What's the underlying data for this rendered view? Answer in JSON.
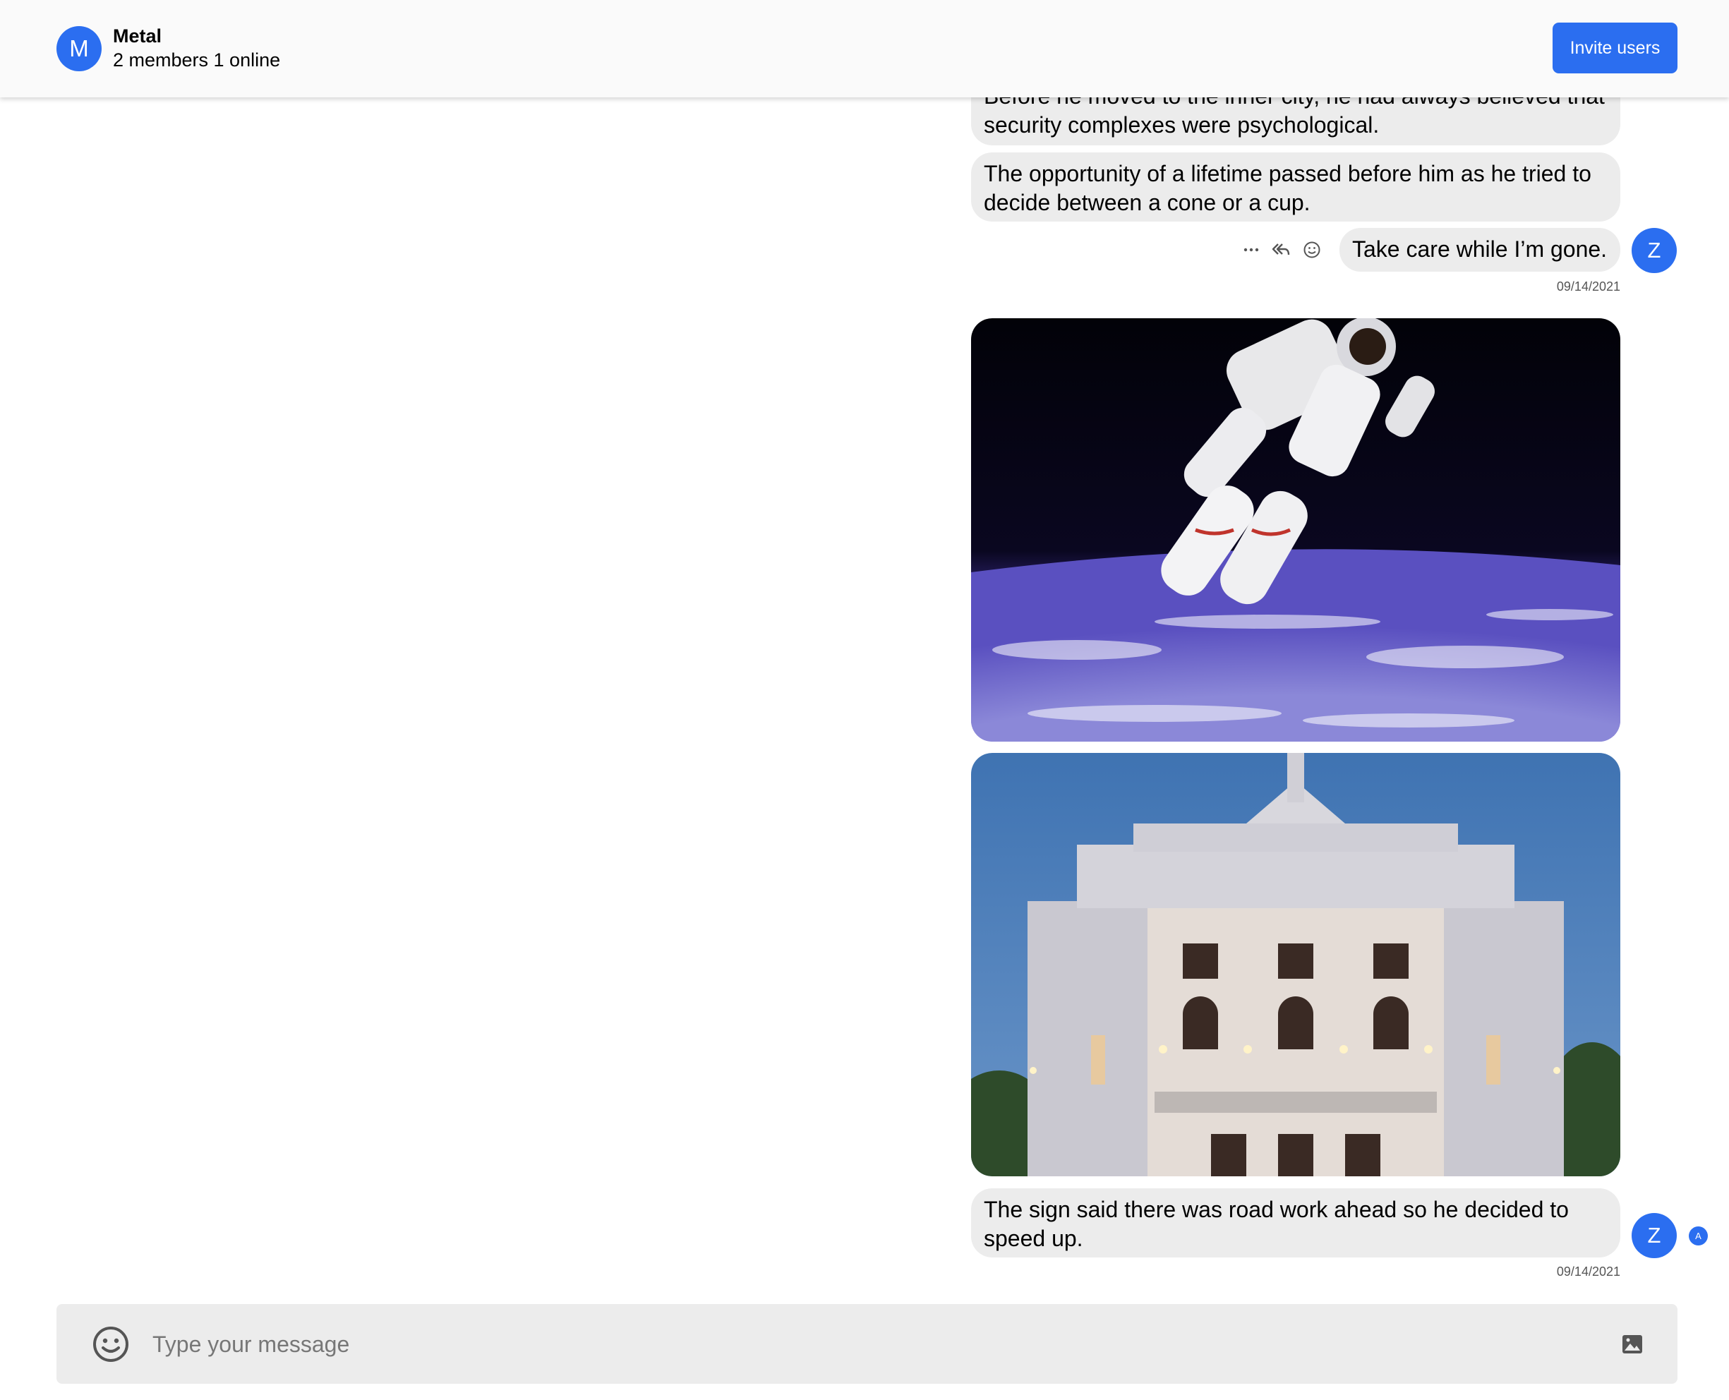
{
  "header": {
    "avatar_letter": "M",
    "title": "Metal",
    "subtitle": "2 members 1 online",
    "invite_label": "Invite users"
  },
  "messages": [
    {
      "text": "Before he moved to the inner city, he had always believed that security complexes were psychological."
    },
    {
      "text": "The opportunity of a lifetime passed before him as he tried to decide between a cone or a cup."
    },
    {
      "text": "Take care while I’m gone.",
      "avatar_letter": "Z",
      "timestamp": "09/14/2021",
      "actions": [
        "more-icon",
        "reply-all-icon",
        "emoji-react-icon"
      ]
    },
    {
      "image": "astronaut-in-space-photo"
    },
    {
      "image": "theatre-building-photo"
    },
    {
      "text": "The sign said there was road work ahead so he decided to speed up.",
      "avatar_letter": "Z",
      "timestamp": "09/14/2021",
      "read_badge": "A"
    }
  ],
  "composer": {
    "placeholder": "Type your message",
    "emoji_icon": "emoji-icon",
    "image_icon": "image-icon"
  },
  "colors": {
    "accent": "#2b6ef0",
    "bubble": "#ececec",
    "header_bg": "#fafafa"
  }
}
